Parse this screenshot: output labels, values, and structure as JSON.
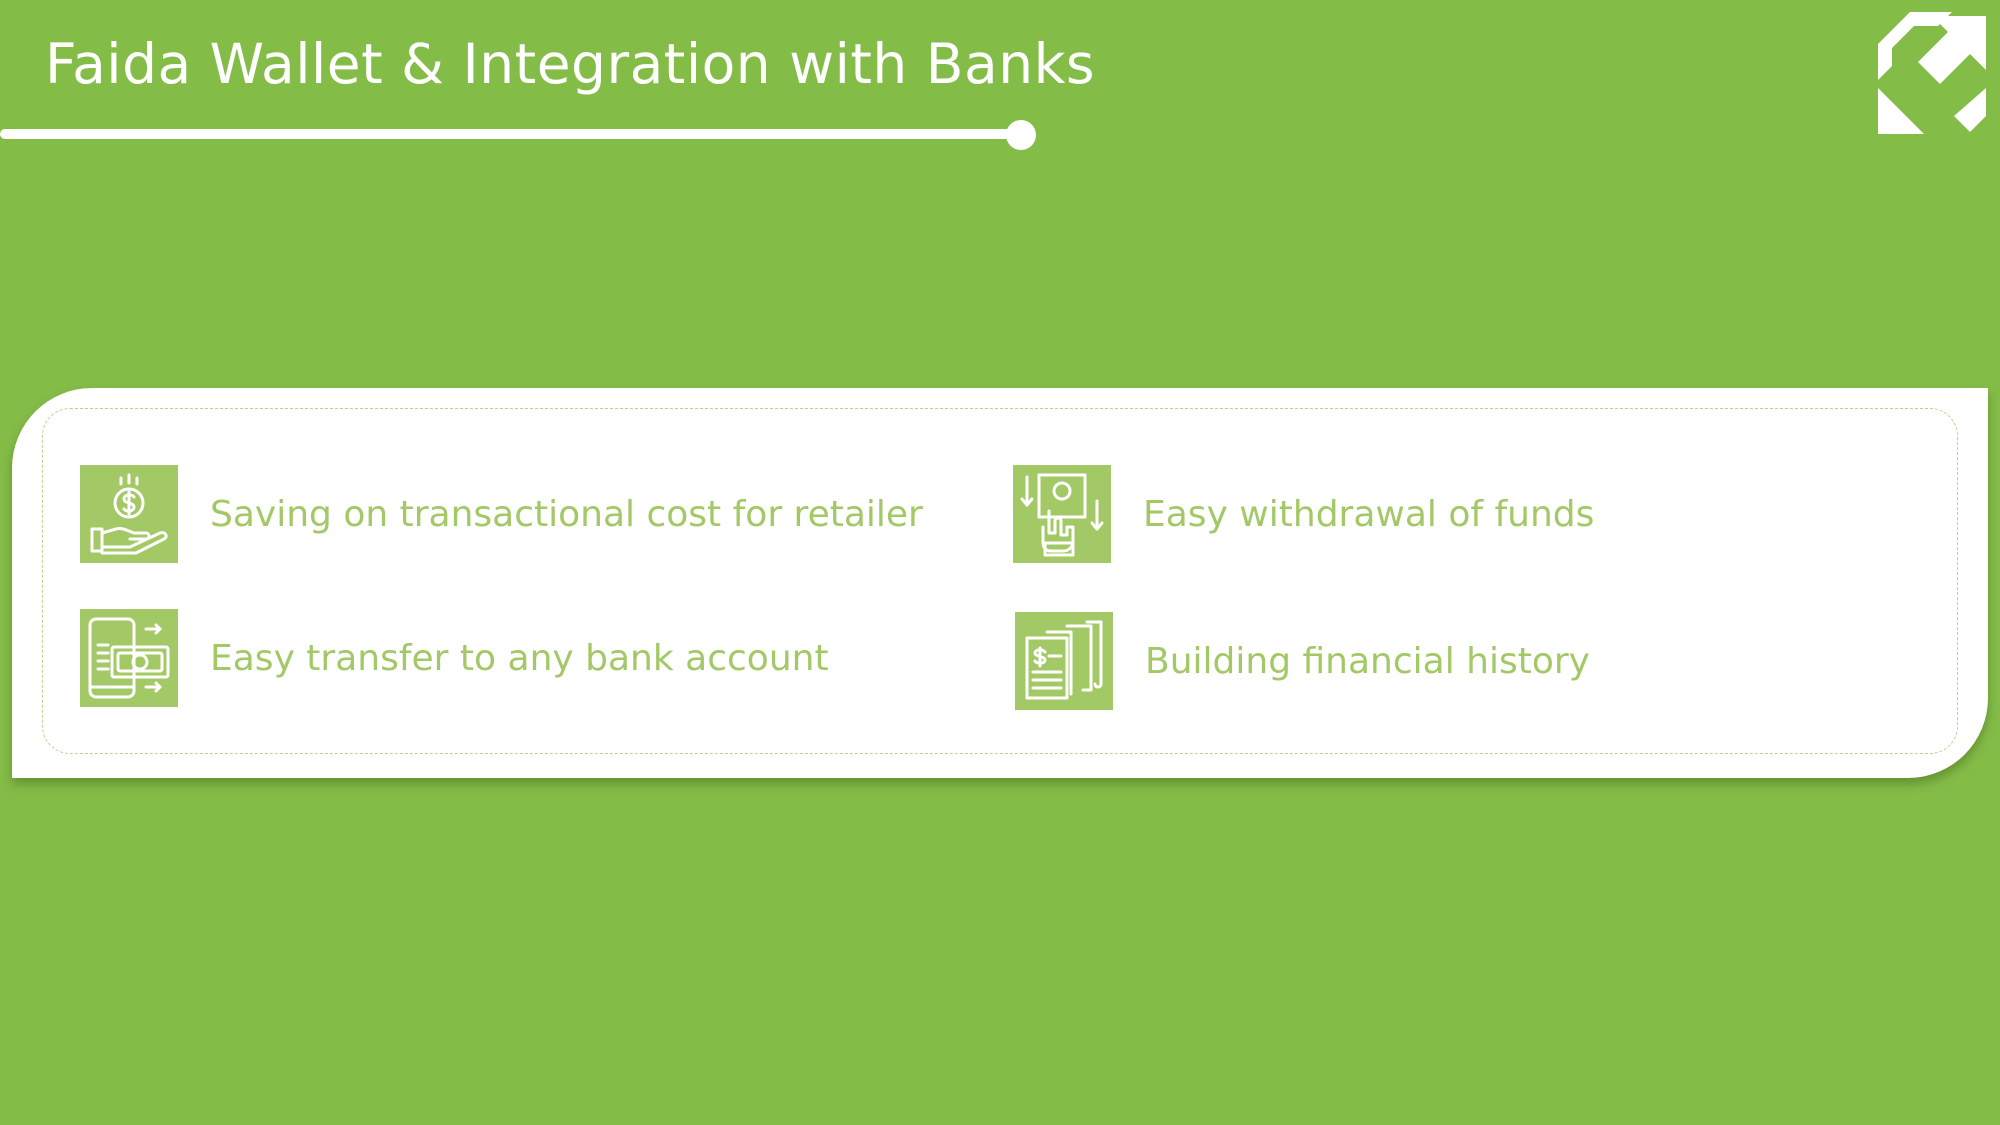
{
  "slide": {
    "title": "Faida Wallet & Integration with Banks"
  },
  "logo": {
    "icon": "brand-arrow-logo"
  },
  "features": [
    {
      "label": "Saving on transactional cost for retailer",
      "icon": "hand-coin-icon"
    },
    {
      "label": "Easy withdrawal of funds",
      "icon": "cash-withdrawal-icon"
    },
    {
      "label": "Easy transfer to any bank account",
      "icon": "phone-money-transfer-icon"
    },
    {
      "label": "Building financial history",
      "icon": "financial-documents-icon"
    }
  ],
  "colors": {
    "background": "#84bc48",
    "accent": "#a3c866",
    "card": "#ffffff"
  }
}
